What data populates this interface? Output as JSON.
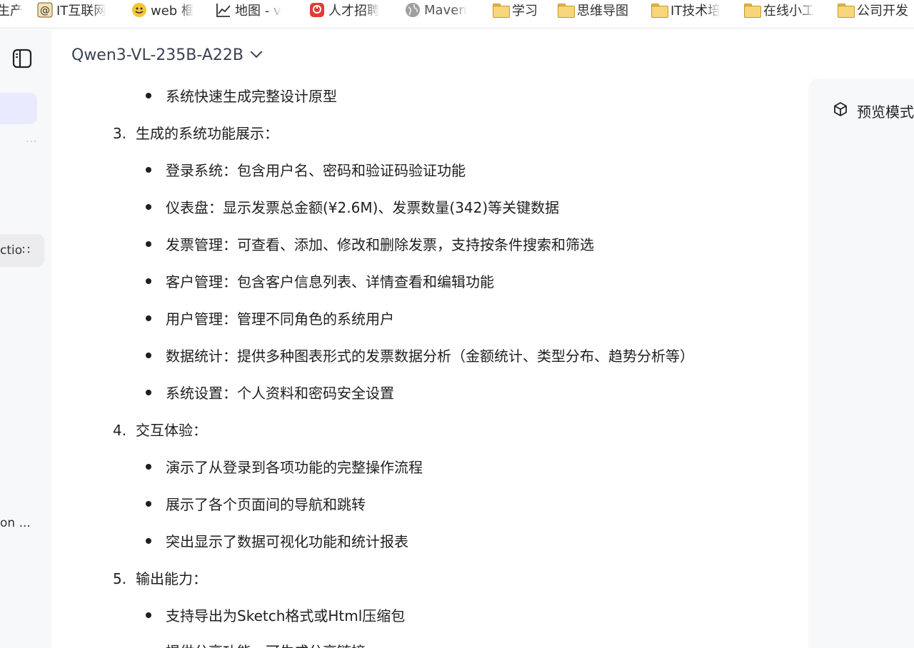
{
  "bookmarks": [
    {
      "label": "生产",
      "icon": "none"
    },
    {
      "label": "IT互联网",
      "icon": "at-sign-icon"
    },
    {
      "label": "web 框",
      "icon": "smiley-icon"
    },
    {
      "label": "地图 - v",
      "icon": "chart-line-icon"
    },
    {
      "label": "人才招聘",
      "icon": "app-red-icon"
    },
    {
      "label": "Maven",
      "icon": "globe-icon"
    },
    {
      "label": "学习",
      "icon": "folder-icon"
    },
    {
      "label": "思维导图",
      "icon": "folder-icon"
    },
    {
      "label": "IT技术培",
      "icon": "folder-icon"
    },
    {
      "label": "在线小工",
      "icon": "folder-icon"
    },
    {
      "label": "公司开发",
      "icon": "folder-icon"
    }
  ],
  "sidebar": {
    "toggle_icon": "sidebar-toggle-icon",
    "more": "···",
    "item_truncated_1": "ctio∷",
    "item_truncated_2": "on ..."
  },
  "model_selector": {
    "label": "Qwen3-VL-235B-A22B"
  },
  "preview": {
    "label": "预览模式"
  },
  "content": {
    "top_bullet": "系统快速生成完整设计原型",
    "sections": [
      {
        "num": "3.",
        "title": "生成的系统功能展示：",
        "items": [
          "登录系统：包含用户名、密码和验证码验证功能",
          "仪表盘：显示发票总金额(¥2.6M)、发票数量(342)等关键数据",
          "发票管理：可查看、添加、修改和删除发票，支持按条件搜索和筛选",
          "客户管理：包含客户信息列表、详情查看和编辑功能",
          "用户管理：管理不同角色的系统用户",
          "数据统计：提供多种图表形式的发票数据分析（金额统计、类型分布、趋势分析等）",
          "系统设置：个人资料和密码安全设置"
        ]
      },
      {
        "num": "4.",
        "title": "交互体验：",
        "items": [
          "演示了从登录到各项功能的完整操作流程",
          "展示了各个页面间的导航和跳转",
          "突出显示了数据可视化功能和统计报表"
        ]
      },
      {
        "num": "5.",
        "title": "输出能力：",
        "items": [
          "支持导出为Sketch格式或Html压缩包",
          "提供分享功能，可生成分享链接"
        ]
      }
    ]
  }
}
